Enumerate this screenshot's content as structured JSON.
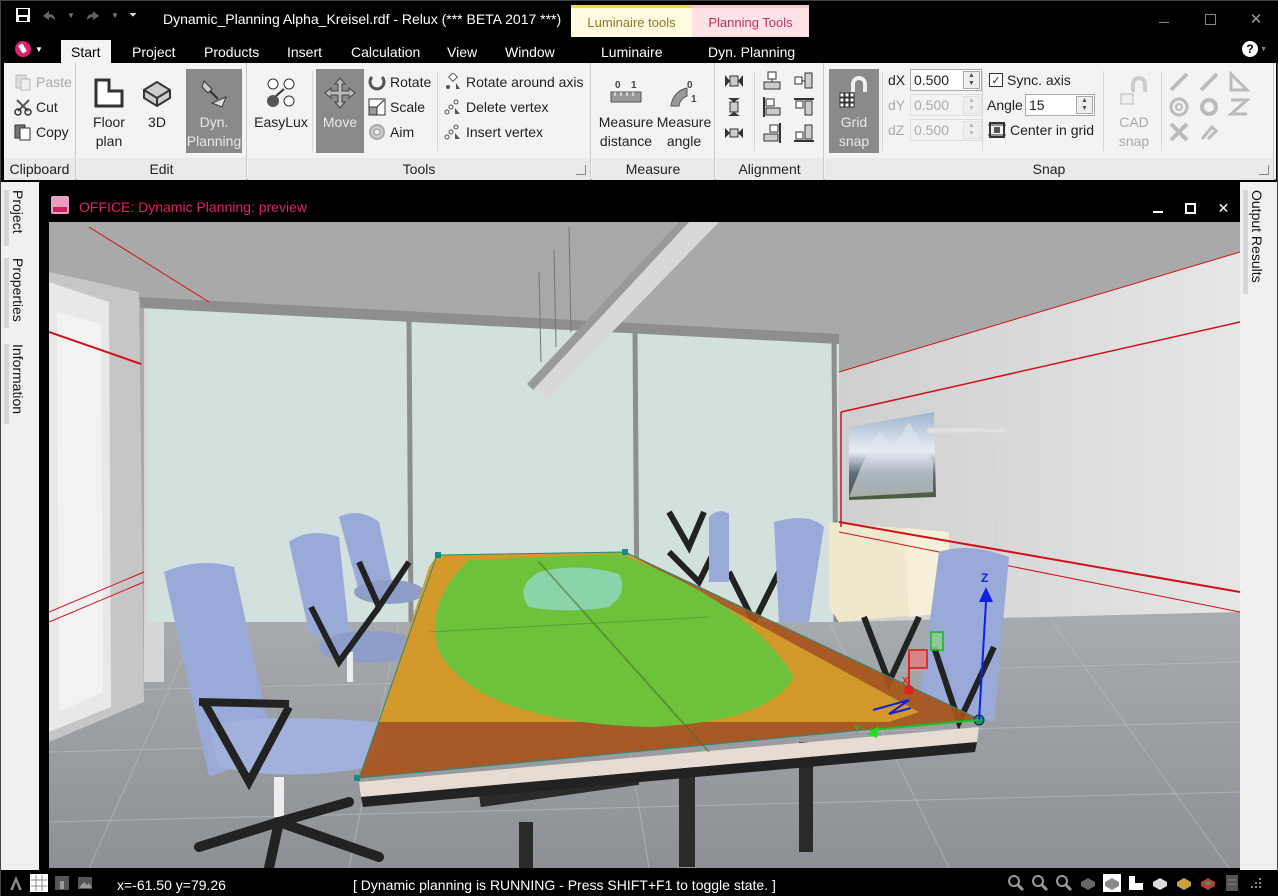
{
  "window": {
    "title": "Dynamic_Planning Alpha_Kreisel.rdf - Relux (*** BETA 2017 ***)",
    "contextual_tabs": [
      {
        "label": "Luminaire tools",
        "color": "#8a7a2a",
        "bg": "#fffbe0"
      },
      {
        "label": "Planning Tools",
        "color": "#c0335a",
        "bg": "#fde2e6"
      }
    ],
    "controls": {
      "minimize": "–",
      "maximize": "☐",
      "close": "✕"
    }
  },
  "quick_access": {
    "save_icon": "save-icon",
    "undo_icon": "undo-icon",
    "redo_icon": "redo-icon"
  },
  "ribbon_tabs": [
    {
      "label": "Start",
      "active": true
    },
    {
      "label": "Project"
    },
    {
      "label": "Products"
    },
    {
      "label": "Insert"
    },
    {
      "label": "Calculation"
    },
    {
      "label": "View"
    },
    {
      "label": "Window"
    },
    {
      "label": "Luminaire"
    },
    {
      "label": "Dyn. Planning"
    }
  ],
  "ribbon": {
    "clipboard": {
      "label": "Clipboard",
      "paste": "Paste",
      "cut": "Cut",
      "copy": "Copy"
    },
    "edit": {
      "label": "Edit",
      "floor_plan": [
        "Floor",
        "plan"
      ],
      "three_d": "3D",
      "dyn_planning": [
        "Dyn.",
        "Planning"
      ]
    },
    "tools": {
      "label": "Tools",
      "easylux": "EasyLux",
      "move": "Move",
      "rotate": "Rotate",
      "scale": "Scale",
      "aim": "Aim",
      "rotate_axis": "Rotate around axis",
      "delete_vertex": "Delete vertex",
      "insert_vertex": "Insert vertex"
    },
    "measure": {
      "label": "Measure",
      "distance": [
        "Measure",
        "distance"
      ],
      "angle": [
        "Measure",
        "angle"
      ]
    },
    "alignment": {
      "label": "Alignment"
    },
    "snap": {
      "label": "Snap",
      "grid_snap": [
        "Grid",
        "snap"
      ],
      "dx_label": "dX",
      "dx": "0.500",
      "dy_label": "dY",
      "dy": "0.500",
      "dz_label": "dZ",
      "dz": "0.500",
      "sync_axis": "Sync. axis",
      "sync_checked": true,
      "angle_label": "Angle",
      "angle": "15",
      "center_in_grid": "Center in grid",
      "cad_snap": [
        "CAD",
        "snap"
      ]
    }
  },
  "left_dock": [
    "Project",
    "Properties",
    "Information"
  ],
  "right_dock": [
    "Output Results"
  ],
  "document": {
    "title": "OFFICE: Dynamic Planning: preview",
    "title_color": "#e0206c"
  },
  "scene": {
    "gizmo_axes": [
      "X",
      "Y",
      "Z"
    ],
    "colors": {
      "wall": "#d8d8d8",
      "ceiling": "#a9a9a9",
      "glass": "#d2e0de",
      "floor": "#9c9fa3",
      "chair": "#9aaad8",
      "isoline_green": "#6cc23a",
      "isoline_orange": "#d59c2a",
      "isoline_brown": "#a8541a",
      "isoline_cyan": "#8fd6b8",
      "room_edge": "#d0101a"
    }
  },
  "status": {
    "coords": "x=-61.50 y=79.26",
    "message": "[ Dynamic planning is RUNNING - Press SHIFT+F1 to toggle state. ]"
  }
}
